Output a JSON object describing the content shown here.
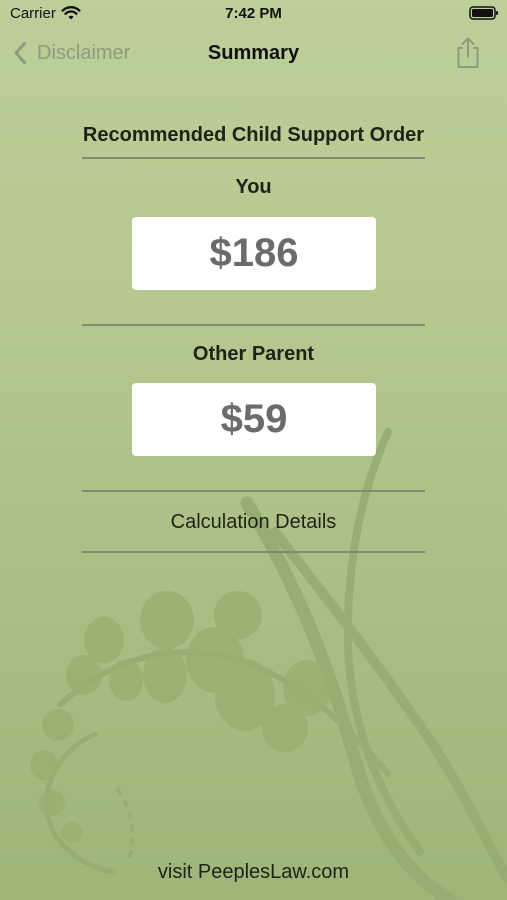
{
  "status_bar": {
    "carrier": "Carrier",
    "time": "7:42 PM",
    "icons": [
      "wifi-icon",
      "battery-icon"
    ]
  },
  "nav": {
    "back_label": "Disclaimer",
    "title": "Summary",
    "back_icon": "chevron-left-icon",
    "share_icon": "share-icon"
  },
  "summary": {
    "heading": "Recommended Child Support Order",
    "you_label": "You",
    "you_amount": "$186",
    "other_label": "Other Parent",
    "other_amount": "$59",
    "details_label": "Calculation Details"
  },
  "footer": {
    "link": "visit PeeplesLaw.com"
  },
  "colors": {
    "background_top": "#bccf99",
    "background_bottom": "#9db678",
    "back_button": "#8e9b7e",
    "amount_text": "#6b6b6b",
    "divider": "#7f8c70"
  }
}
